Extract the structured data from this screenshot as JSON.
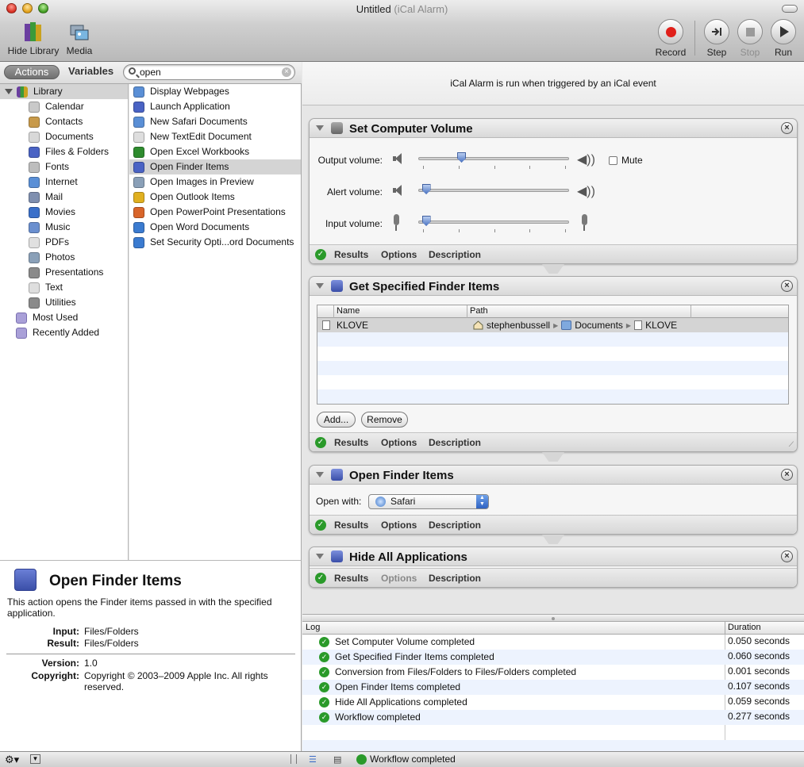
{
  "window": {
    "title": "Untitled",
    "subtitle": "(iCal Alarm)"
  },
  "toolbar": {
    "hide_library": "Hide Library",
    "media": "Media",
    "record": "Record",
    "step": "Step",
    "stop": "Stop",
    "run": "Run"
  },
  "library_tabs": {
    "actions": "Actions",
    "variables": "Variables"
  },
  "search": {
    "value": "open"
  },
  "library": {
    "root": "Library",
    "items": [
      {
        "label": "Calendar",
        "icon": "calendar-icon",
        "color": "#c9c9c9"
      },
      {
        "label": "Contacts",
        "icon": "contacts-icon",
        "color": "#c89a4a"
      },
      {
        "label": "Documents",
        "icon": "documents-icon",
        "color": "#d8d8d8"
      },
      {
        "label": "Files & Folders",
        "icon": "finder-icon",
        "color": "#4a63c4"
      },
      {
        "label": "Fonts",
        "icon": "fonts-icon",
        "color": "#bdbdbd"
      },
      {
        "label": "Internet",
        "icon": "internet-icon",
        "color": "#5a8fd6"
      },
      {
        "label": "Mail",
        "icon": "mail-icon",
        "color": "#7f8faf"
      },
      {
        "label": "Movies",
        "icon": "movies-icon",
        "color": "#3a6fc9"
      },
      {
        "label": "Music",
        "icon": "music-icon",
        "color": "#6a8fcf"
      },
      {
        "label": "PDFs",
        "icon": "pdf-icon",
        "color": "#e0e0e0"
      },
      {
        "label": "Photos",
        "icon": "photos-icon",
        "color": "#8aa0b8"
      },
      {
        "label": "Presentations",
        "icon": "presentations-icon",
        "color": "#8a8a8a"
      },
      {
        "label": "Text",
        "icon": "text-icon",
        "color": "#dedede"
      },
      {
        "label": "Utilities",
        "icon": "utilities-icon",
        "color": "#8a8a8a"
      }
    ],
    "extra": [
      "Most Used",
      "Recently Added"
    ]
  },
  "actions_list": [
    {
      "label": "Display Webpages",
      "color": "#5a8fd6"
    },
    {
      "label": "Launch Application",
      "color": "#4a63c4"
    },
    {
      "label": "New Safari Documents",
      "color": "#5a8fd6"
    },
    {
      "label": "New TextEdit Document",
      "color": "#dedede"
    },
    {
      "label": "Open Excel Workbooks",
      "color": "#2e8b2e"
    },
    {
      "label": "Open Finder Items",
      "color": "#4a63c4"
    },
    {
      "label": "Open Images in Preview",
      "color": "#8aa0b8"
    },
    {
      "label": "Open Outlook Items",
      "color": "#e0b020"
    },
    {
      "label": "Open PowerPoint Presentations",
      "color": "#d8652a"
    },
    {
      "label": "Open Word Documents",
      "color": "#3b7bd0"
    },
    {
      "label": "Set Security Opti...ord Documents",
      "color": "#3b7bd0"
    }
  ],
  "selected_action_index": 5,
  "description": {
    "title": "Open Finder Items",
    "text": "This action opens the Finder items passed in with the specified application.",
    "input_label": "Input:",
    "input": "Files/Folders",
    "result_label": "Result:",
    "result": "Files/Folders",
    "version_label": "Version:",
    "version": "1.0",
    "copyright_label": "Copyright:",
    "copyright": "Copyright © 2003–2009 Apple Inc.  All rights reserved."
  },
  "workflow": {
    "banner": "iCal Alarm is run when triggered by an iCal event",
    "footer_tabs": {
      "results": "Results",
      "options": "Options",
      "description": "Description"
    },
    "set_volume": {
      "title": "Set Computer Volume",
      "output_label": "Output volume:",
      "alert_label": "Alert volume:",
      "input_label": "Input volume:",
      "output_level": 0.27,
      "alert_level": 0.02,
      "input_level": 0.02,
      "mute_label": "Mute"
    },
    "get_items": {
      "title": "Get Specified Finder Items",
      "col_name": "Name",
      "col_path": "Path",
      "row_name": "KLOVE",
      "path": [
        "stephenbussell",
        "Documents",
        "KLOVE"
      ],
      "add_button": "Add...",
      "remove_button": "Remove"
    },
    "open_items": {
      "title": "Open Finder Items",
      "open_with_label": "Open with:",
      "app": "Safari"
    },
    "hide_apps": {
      "title": "Hide All Applications"
    }
  },
  "log": {
    "col_log": "Log",
    "col_duration": "Duration",
    "rows": [
      {
        "text": "Set Computer Volume completed",
        "duration": "0.050 seconds"
      },
      {
        "text": "Get Specified Finder Items completed",
        "duration": "0.060 seconds"
      },
      {
        "text": "Conversion from Files/Folders to Files/Folders completed",
        "duration": "0.001 seconds"
      },
      {
        "text": "Open Finder Items completed",
        "duration": "0.107 seconds"
      },
      {
        "text": "Hide All Applications completed",
        "duration": "0.059 seconds"
      },
      {
        "text": "Workflow completed",
        "duration": "0.277 seconds"
      }
    ]
  },
  "status": {
    "text": "Workflow completed"
  },
  "colors": {
    "success": "#2a9a2a",
    "record_red": "#e0201a",
    "selection": "#d4d4d4",
    "alt_row": "#edf3fe"
  }
}
